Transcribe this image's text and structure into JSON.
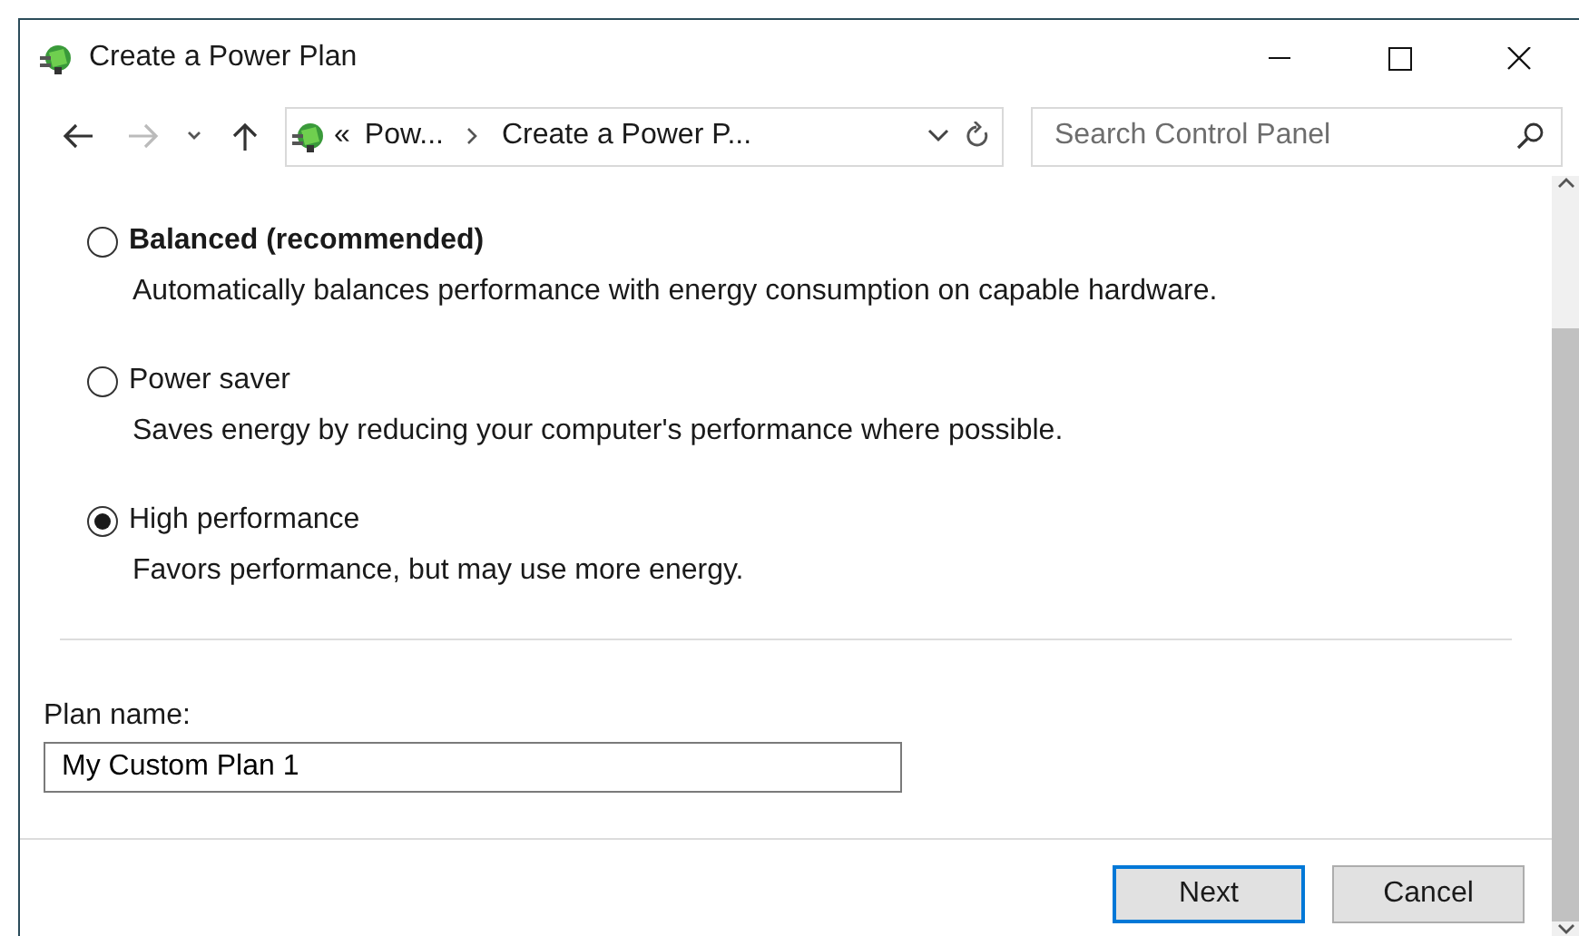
{
  "window": {
    "title": "Create a Power Plan"
  },
  "address_bar": {
    "overflow": "«",
    "breadcrumbs": [
      "Pow...",
      "Create a Power P..."
    ]
  },
  "search": {
    "placeholder": "Search Control Panel"
  },
  "plans": [
    {
      "label": "Balanced (recommended)",
      "description": "Automatically balances performance with energy consumption on capable hardware.",
      "recommended": true,
      "selected": false
    },
    {
      "label": "Power saver",
      "description": "Saves energy by reducing your computer's performance where possible.",
      "recommended": false,
      "selected": false
    },
    {
      "label": "High performance",
      "description": "Favors performance, but may use more energy.",
      "recommended": false,
      "selected": true
    }
  ],
  "plan_name": {
    "label": "Plan name:",
    "value": "My Custom Plan 1"
  },
  "buttons": [
    {
      "label": "Next",
      "default": true
    },
    {
      "label": "Cancel",
      "default": false
    }
  ]
}
